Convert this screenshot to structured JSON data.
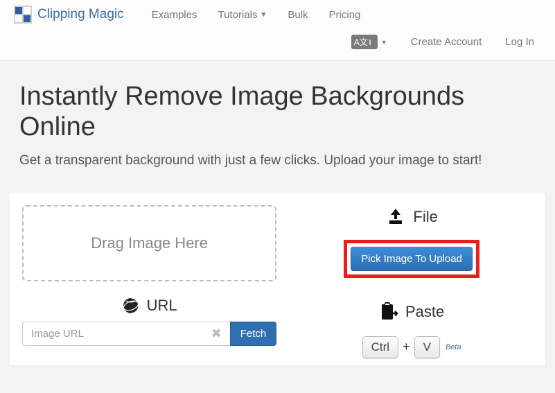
{
  "nav": {
    "brand": "Clipping Magic",
    "links": {
      "examples": "Examples",
      "tutorials": "Tutorials",
      "bulk": "Bulk",
      "pricing": "Pricing"
    },
    "lang": "A文",
    "create_account": "Create Account",
    "login": "Log In"
  },
  "hero": {
    "title": "Instantly Remove Image Backgrounds Online",
    "subtitle": "Get a transparent background with just a few clicks. Upload your image to start!"
  },
  "upload": {
    "drag_text": "Drag Image Here",
    "url_label": "URL",
    "url_placeholder": "Image URL",
    "fetch_label": "Fetch",
    "file_label": "File",
    "pick_button": "Pick Image To Upload",
    "paste_label": "Paste",
    "key_ctrl": "Ctrl",
    "key_plus": "+",
    "key_v": "V",
    "beta": "Beta"
  }
}
